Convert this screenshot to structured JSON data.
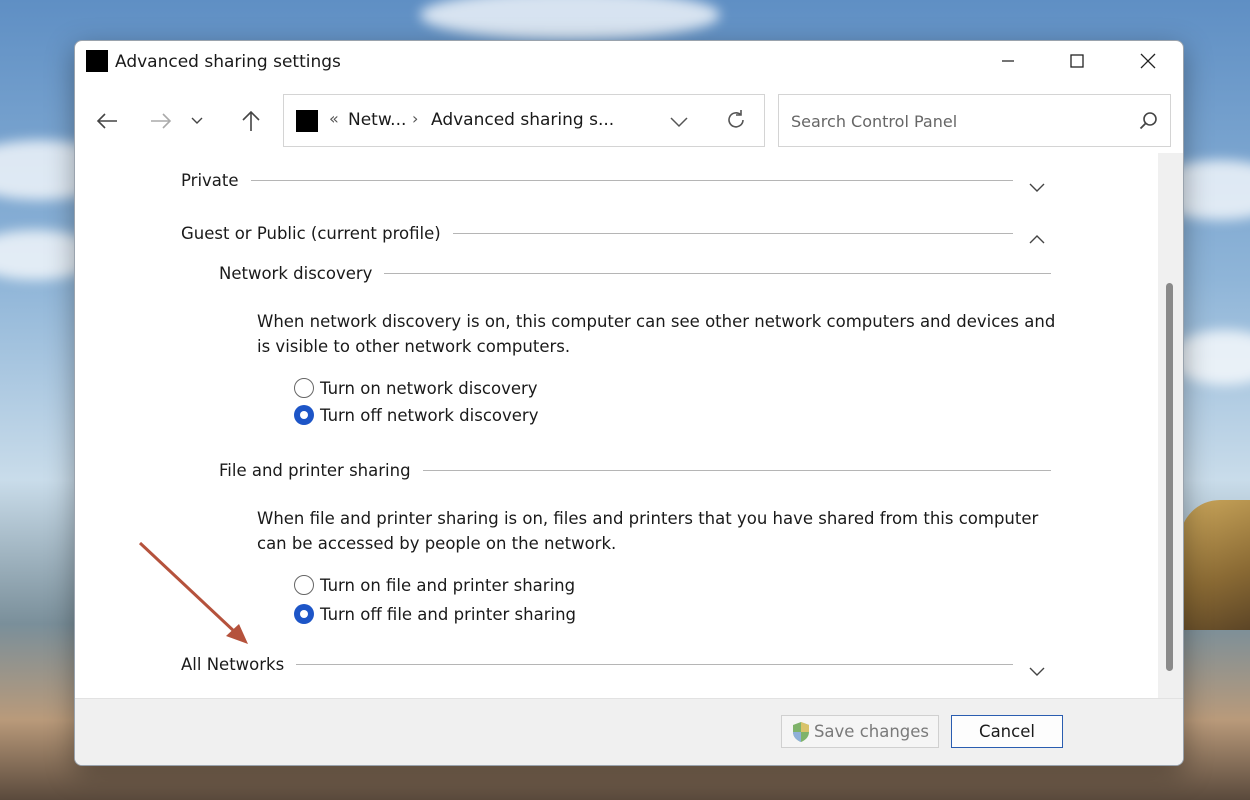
{
  "window": {
    "title": "Advanced sharing settings"
  },
  "address": {
    "prefix": "«",
    "crumb_1": "Netw...",
    "separator": "›",
    "crumb_2": "Advanced sharing s..."
  },
  "search": {
    "placeholder": "Search Control Panel"
  },
  "sections": {
    "private": {
      "label": "Private"
    },
    "guest_public": {
      "label": "Guest or Public (current profile)"
    },
    "network_discovery": {
      "label": "Network discovery",
      "description": "When network discovery is on, this computer can see other network computers and devices and is visible to other network computers.",
      "options": [
        {
          "label": "Turn on network discovery",
          "selected": false
        },
        {
          "label": "Turn off network discovery",
          "selected": true
        }
      ]
    },
    "file_printer_sharing": {
      "label": "File and printer sharing",
      "description": "When file and printer sharing is on, files and printers that you have shared from this computer can be accessed by people on the network.",
      "options": [
        {
          "label": "Turn on file and printer sharing",
          "selected": false
        },
        {
          "label": "Turn off file and printer sharing",
          "selected": true
        }
      ]
    },
    "all_networks": {
      "label": "All Networks"
    }
  },
  "footer": {
    "save_label": "Save changes",
    "cancel_label": "Cancel"
  },
  "colors": {
    "accent": "#1d55c7",
    "annotation_arrow": "#b5523c"
  },
  "icons": [
    "back-arrow-icon",
    "forward-arrow-icon",
    "recent-chevron-icon",
    "up-arrow-icon",
    "dropdown-chevron-icon",
    "refresh-icon",
    "search-icon",
    "shield-icon",
    "minimize-icon",
    "maximize-icon",
    "close-icon",
    "expand-chevron-icon",
    "collapse-chevron-icon"
  ]
}
